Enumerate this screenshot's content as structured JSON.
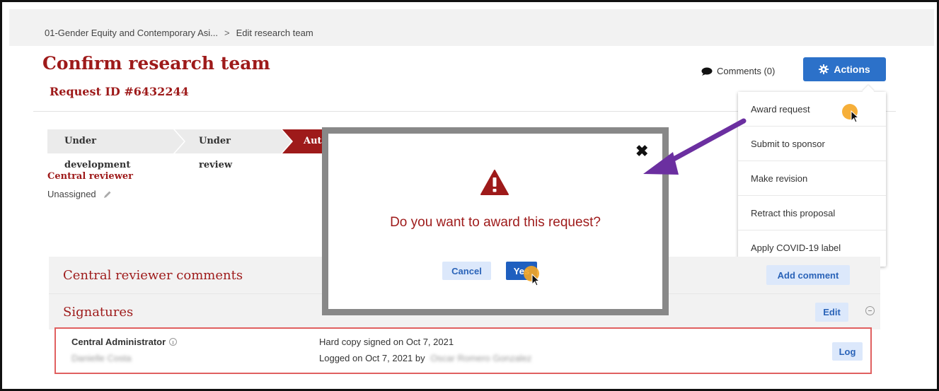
{
  "breadcrumb": {
    "parent": "01-Gender Equity and Contemporary Asi...",
    "separator": ">",
    "current": "Edit research team"
  },
  "page": {
    "title": "Confirm research team",
    "request_id": "Request ID #6432244"
  },
  "header": {
    "comments_label": "Comments (0)",
    "actions_label": "Actions"
  },
  "actions_menu": [
    {
      "label": "Award request"
    },
    {
      "label": "Submit to sponsor"
    },
    {
      "label": "Make revision"
    },
    {
      "label": "Retract this proposal"
    },
    {
      "label": "Apply COVID-19 label"
    }
  ],
  "workflow": {
    "steps": [
      {
        "label": "Under development",
        "state": "done"
      },
      {
        "label": "Under review",
        "state": "done"
      },
      {
        "label": "Aut",
        "state": "current"
      }
    ]
  },
  "central_reviewer": {
    "label": "Central reviewer",
    "value": "Unassigned"
  },
  "sections": {
    "comments_title": "Central reviewer comments",
    "add_comment_label": "Add comment",
    "signatures_title": "Signatures",
    "edit_label": "Edit"
  },
  "signature": {
    "role": "Central Administrator",
    "name": "Danielle Costa",
    "signed_text": "Hard copy signed on Oct 7, 2021",
    "logged_text": "Logged on Oct 7, 2021 by",
    "logged_by": "Oscar Romero Gonzalez",
    "log_label": "Log"
  },
  "modal": {
    "close_label": "✖",
    "question": "Do you want to award this request?",
    "cancel_label": "Cancel",
    "yes_label": "Yes"
  },
  "colors": {
    "brand_red": "#9e1a1a",
    "primary_blue": "#2c71c9",
    "annotation_purple": "#6b2fa0",
    "cursor_highlight": "#f5a623"
  }
}
